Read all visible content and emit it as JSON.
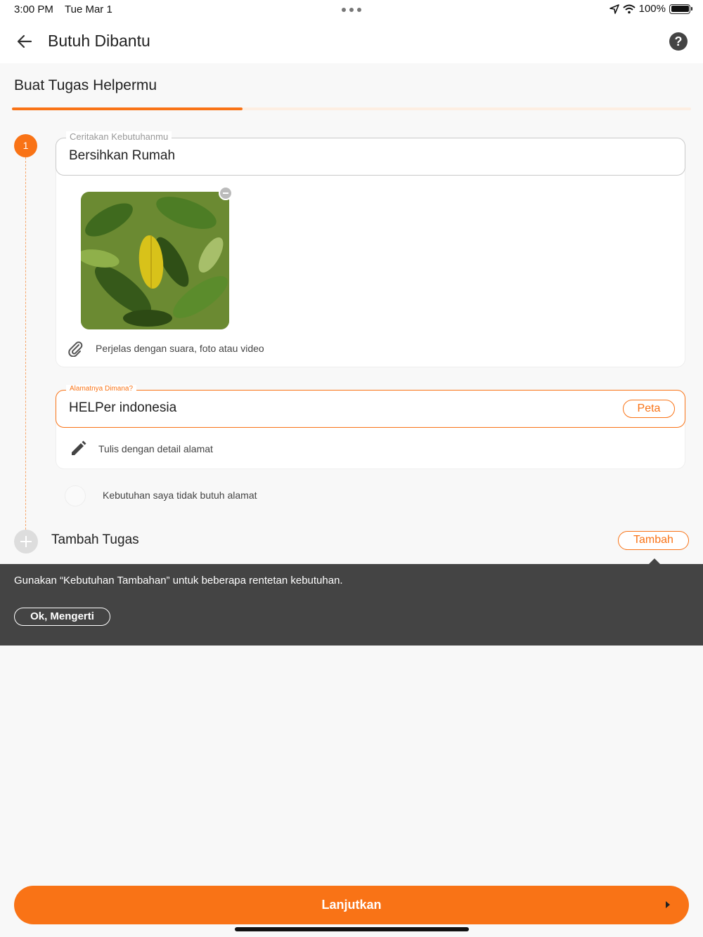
{
  "status_bar": {
    "time": "3:00 PM",
    "date": "Tue Mar 1",
    "battery": "100%"
  },
  "header": {
    "title": "Butuh Dibantu",
    "help_icon": "question-icon"
  },
  "section": {
    "title": "Buat Tugas Helpermu",
    "progress": 0.34
  },
  "step": {
    "number": "1",
    "need_field": {
      "legend": "Ceritakan Kebutuhanmu",
      "value": "Bersihkan Rumah"
    },
    "attachment_hint": "Perjelas dengan suara, foto atau video",
    "address_field": {
      "legend": "Alamatnya Dimana?",
      "value": "HELPer indonesia",
      "map_button": "Peta"
    },
    "address_detail_hint": "Tulis dengan detail alamat",
    "no_address_label": "Kebutuhan saya tidak butuh alamat"
  },
  "add_task": {
    "title": "Tambah Tugas",
    "button": "Tambah"
  },
  "tooltip": {
    "message": "Gunakan “Kebutuhan Tambahan” untuk beberapa rentetan kebutuhan.",
    "button": "Ok, Mengerti"
  },
  "footer": {
    "continue_button": "Lanjutkan"
  },
  "colors": {
    "accent": "#f97316",
    "tooltip_bg": "#444444"
  }
}
